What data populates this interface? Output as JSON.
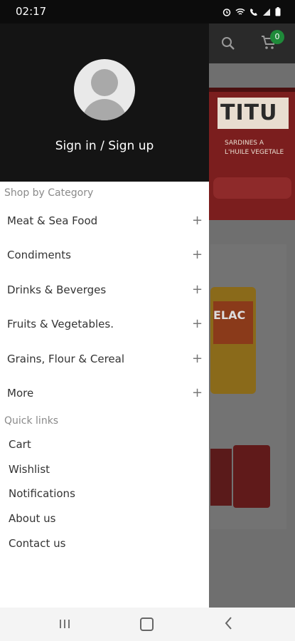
{
  "status_bar": {
    "time": "02:17"
  },
  "app": {
    "cart_count": "0"
  },
  "drawer": {
    "account_label": "Sign in / Sign up",
    "shop_section_label": "Shop by Category",
    "categories": [
      {
        "label": "Meat & Sea Food"
      },
      {
        "label": "Condiments"
      },
      {
        "label": "Drinks & Beverges"
      },
      {
        "label": "Fruits & Vegetables."
      },
      {
        "label": "Grains, Flour & Cereal"
      },
      {
        "label": "More"
      }
    ],
    "expand_symbol": "+",
    "quick_links_label": "Quick links",
    "quick_links": [
      {
        "label": "Cart"
      },
      {
        "label": "Wishlist"
      },
      {
        "label": "Notifications"
      },
      {
        "label": "About us"
      },
      {
        "label": "Contact us"
      }
    ]
  },
  "background": {
    "banner_title": "TITU",
    "banner_subtitle": "SARDINES A L'HUILE VEGETALE",
    "product_label": "ELAC"
  },
  "colors": {
    "drawer_header": "#141414",
    "badge": "#1f8a3a",
    "scrim": "#6f6f6f"
  }
}
